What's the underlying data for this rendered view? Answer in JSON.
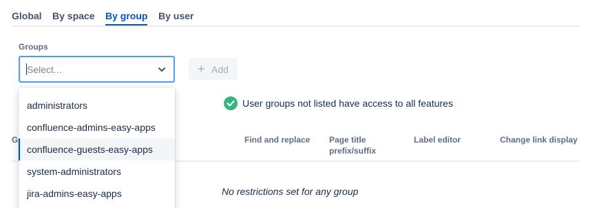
{
  "tabs": [
    {
      "label": "Global"
    },
    {
      "label": "By space"
    },
    {
      "label": "By group",
      "active": true
    },
    {
      "label": "By user"
    }
  ],
  "groups": {
    "label": "Groups",
    "placeholder": "Select..."
  },
  "add_button": {
    "label": "Add",
    "icon": "plus-icon",
    "disabled": true
  },
  "info": {
    "icon": "check-circle-icon",
    "text": "User groups not listed have access to all features",
    "color": "#36b37e"
  },
  "table": {
    "headers": [
      "G",
      "Find and replace",
      "Page title prefix/suffix",
      "Label editor",
      "Change link display"
    ],
    "empty_text": "No restrictions set for any group"
  },
  "dropdown": {
    "options": [
      {
        "label": "administrators"
      },
      {
        "label": "confluence-admins-easy-apps"
      },
      {
        "label": "confluence-guests-easy-apps",
        "highlighted": true
      },
      {
        "label": "system-administrators"
      },
      {
        "label": "jira-admins-easy-apps"
      }
    ]
  },
  "colors": {
    "accent": "#0052cc",
    "focus_border": "#4c9aff",
    "text": "#172b4d",
    "muted": "#5e6c84"
  }
}
